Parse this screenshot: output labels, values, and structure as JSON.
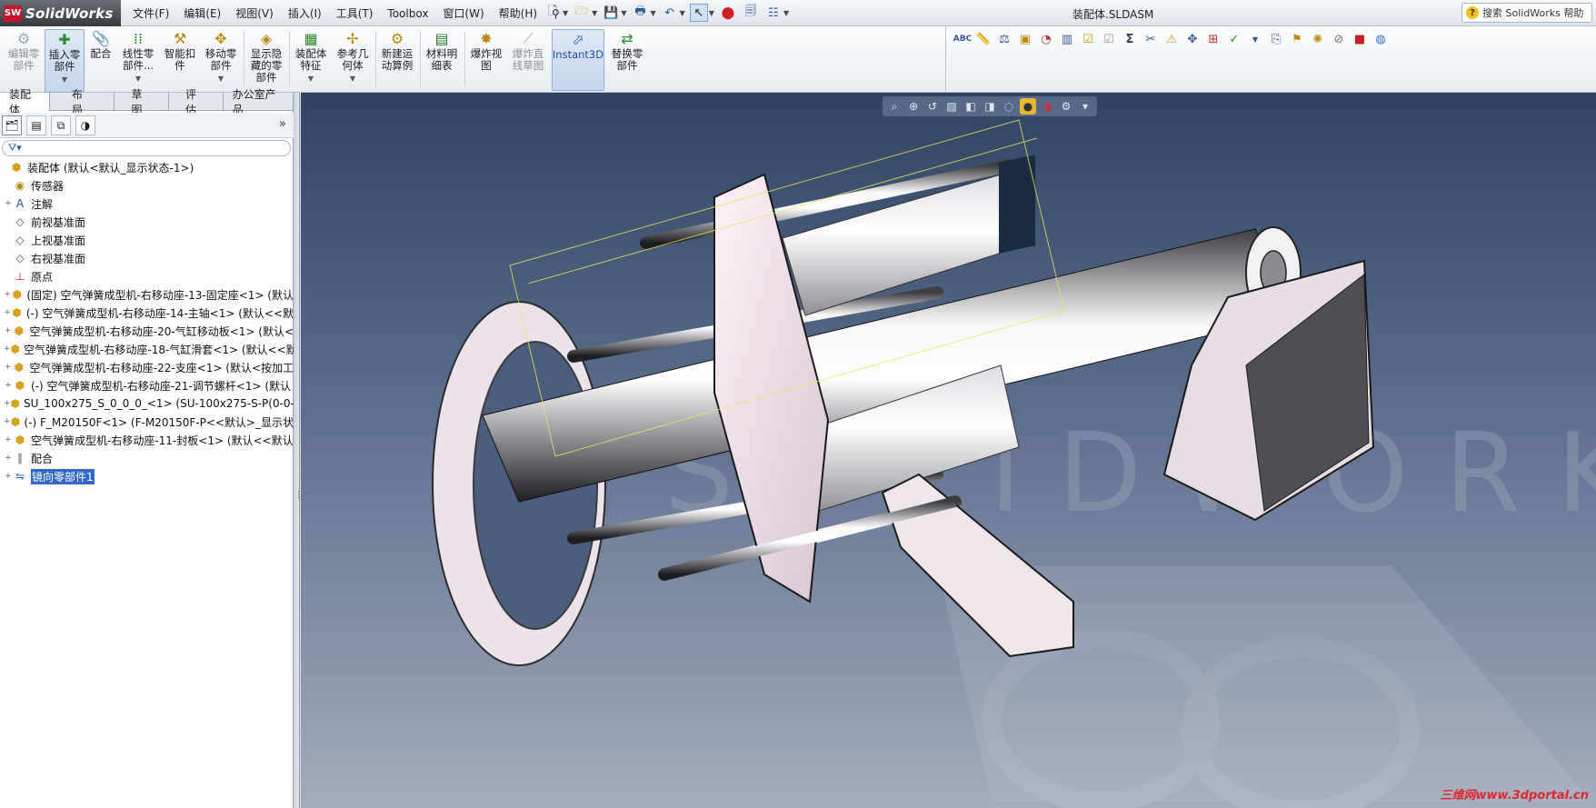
{
  "app": {
    "logo_mark": "SW",
    "logo_name": "SolidWorks",
    "doc_title": "装配体.SLDASM"
  },
  "menu": [
    "文件(F)",
    "编辑(E)",
    "视图(V)",
    "插入(I)",
    "工具(T)",
    "Toolbox",
    "窗口(W)",
    "帮助(H)"
  ],
  "search": {
    "placeholder": "搜索 SolidWorks 帮助"
  },
  "commands": [
    {
      "label": "编辑零\n部件",
      "icon": "edit-component-icon",
      "disabled": true
    },
    {
      "label": "插入零\n部件",
      "icon": "insert-components-icon"
    },
    {
      "label": "配合",
      "icon": "mate-icon"
    },
    {
      "label": "线性零\n部件...",
      "icon": "linear-pattern-icon"
    },
    {
      "label": "智能扣\n件",
      "icon": "smart-fasteners-icon"
    },
    {
      "label": "移动零\n部件",
      "icon": "move-component-icon"
    },
    {
      "label": "显示隐\n藏的零\n部件",
      "icon": "show-hidden-icon"
    },
    {
      "label": "装配体\n特征",
      "icon": "assembly-features-icon"
    },
    {
      "label": "参考几\n何体",
      "icon": "reference-geometry-icon"
    },
    {
      "label": "新建运\n动算例",
      "icon": "motion-study-icon"
    },
    {
      "label": "材料明\n细表",
      "icon": "bom-icon"
    },
    {
      "label": "爆炸视\n图",
      "icon": "exploded-view-icon"
    },
    {
      "label": "爆炸直\n线草图",
      "icon": "explode-line-icon",
      "disabled": true
    },
    {
      "label": "Instant3D",
      "icon": "instant3d-icon",
      "active": true
    },
    {
      "label": "替换零\n部件",
      "icon": "replace-components-icon"
    }
  ],
  "cm_tabs": [
    "装配体",
    "布局",
    "草图",
    "评估",
    "办公室产品"
  ],
  "tree": [
    {
      "label": "装配体  (默认<默认_显示状态-1>)",
      "icon": "assembly-icon",
      "level": 0,
      "expander": ""
    },
    {
      "label": "传感器",
      "icon": "sensor-icon",
      "level": 1,
      "expander": ""
    },
    {
      "label": "注解",
      "icon": "annotation-icon",
      "level": 1,
      "expander": "+"
    },
    {
      "label": "前视基准面",
      "icon": "plane-icon",
      "level": 1,
      "expander": ""
    },
    {
      "label": "上视基准面",
      "icon": "plane-icon",
      "level": 1,
      "expander": ""
    },
    {
      "label": "右视基准面",
      "icon": "plane-icon",
      "level": 1,
      "expander": ""
    },
    {
      "label": "原点",
      "icon": "origin-icon",
      "level": 1,
      "expander": ""
    },
    {
      "label": "(固定) 空气弹簧成型机-右移动座-13-固定座<1> (默认",
      "icon": "part-icon",
      "level": 1,
      "expander": "+"
    },
    {
      "label": "(-) 空气弹簧成型机-右移动座-14-主轴<1> (默认<<默",
      "icon": "part-icon",
      "level": 1,
      "expander": "+"
    },
    {
      "label": "空气弹簧成型机-右移动座-20-气缸移动板<1> (默认<",
      "icon": "part-icon",
      "level": 1,
      "expander": "+"
    },
    {
      "label": "空气弹簧成型机-右移动座-18-气缸滑套<1> (默认<<默",
      "icon": "part-icon",
      "level": 1,
      "expander": "+"
    },
    {
      "label": "空气弹簧成型机-右移动座-22-支座<1> (默认<按加工",
      "icon": "part-icon",
      "level": 1,
      "expander": "+"
    },
    {
      "label": "(-) 空气弹簧成型机-右移动座-21-调节螺杆<1> (默认",
      "icon": "part-icon",
      "level": 1,
      "expander": "+"
    },
    {
      "label": "SU_100x275_S_0_0_0_<1> (SU-100x275-S-P(0-0-0",
      "icon": "subassembly-icon",
      "level": 1,
      "expander": "+"
    },
    {
      "label": "(-) F_M20150F<1> (F-M20150F-P<<默认>_显示状",
      "icon": "part-icon",
      "level": 1,
      "expander": "+"
    },
    {
      "label": "空气弹簧成型机-右移动座-11-封板<1> (默认<<默认",
      "icon": "part-icon",
      "level": 1,
      "expander": "+"
    },
    {
      "label": "配合",
      "icon": "mates-icon",
      "level": 1,
      "expander": "+"
    },
    {
      "label": "镜向零部件1",
      "icon": "mirror-components-icon",
      "level": 1,
      "expander": "+",
      "selected": true
    }
  ],
  "watermark": "三维网www.3dportal.cn",
  "colors": {
    "accent": "#3169c6",
    "viewport_top": "#2f4465",
    "viewport_bottom": "#a4acbd"
  }
}
